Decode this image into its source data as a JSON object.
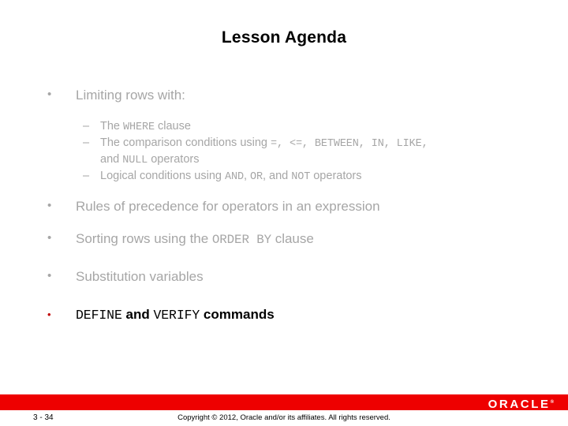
{
  "slide": {
    "title": "Lesson Agenda",
    "bullet_glyph": "•",
    "dash_glyph": "–",
    "colors": {
      "body_gray": "#a6a6a6",
      "emphasis_black": "#000000",
      "accent_red": "#c00000",
      "bar_red": "#ee0000"
    },
    "bullets": [
      {
        "text": "Limiting rows with:",
        "sub_items": [
          {
            "lines": [
              [
                {
                  "t": "The ",
                  "mono": false
                },
                {
                  "t": "WHERE",
                  "mono": true
                },
                {
                  "t": " clause",
                  "mono": false
                }
              ]
            ]
          },
          {
            "lines": [
              [
                {
                  "t": "The comparison conditions using ",
                  "mono": false
                },
                {
                  "t": "=, <=, BETWEEN, IN, LIKE,",
                  "mono": true
                }
              ],
              [
                {
                  "t": "and ",
                  "mono": false
                },
                {
                  "t": "NULL",
                  "mono": true
                },
                {
                  "t": " operators",
                  "mono": false
                }
              ]
            ]
          },
          {
            "lines": [
              [
                {
                  "t": "Logical conditions using ",
                  "mono": false
                },
                {
                  "t": "AND",
                  "mono": true
                },
                {
                  "t": ", ",
                  "mono": false
                },
                {
                  "t": "OR",
                  "mono": true
                },
                {
                  "t": ", and ",
                  "mono": false
                },
                {
                  "t": "NOT",
                  "mono": true
                },
                {
                  "t": " operators",
                  "mono": false
                }
              ]
            ]
          }
        ]
      },
      {
        "text": "Rules of precedence for operators in an expression",
        "sub_items": []
      },
      {
        "parts": [
          {
            "t": "Sorting rows using the ",
            "mono": false
          },
          {
            "t": "ORDER BY",
            "mono": true
          },
          {
            "t": " clause",
            "mono": false
          }
        ],
        "sub_items": []
      },
      {
        "text": "Substitution variables",
        "sub_items": []
      },
      {
        "emphasis": true,
        "parts": [
          {
            "t": "DEFINE",
            "mono": true
          },
          {
            "t": " and ",
            "mono": false
          },
          {
            "t": "VERIFY",
            "mono": true
          },
          {
            "t": " commands",
            "mono": false
          }
        ],
        "sub_items": []
      }
    ]
  },
  "footer": {
    "logo_text": "ORACLE",
    "logo_tm": "®",
    "page_number": "3 - 34",
    "copyright": "Copyright © 2012, Oracle and/or its affiliates. All rights reserved."
  }
}
